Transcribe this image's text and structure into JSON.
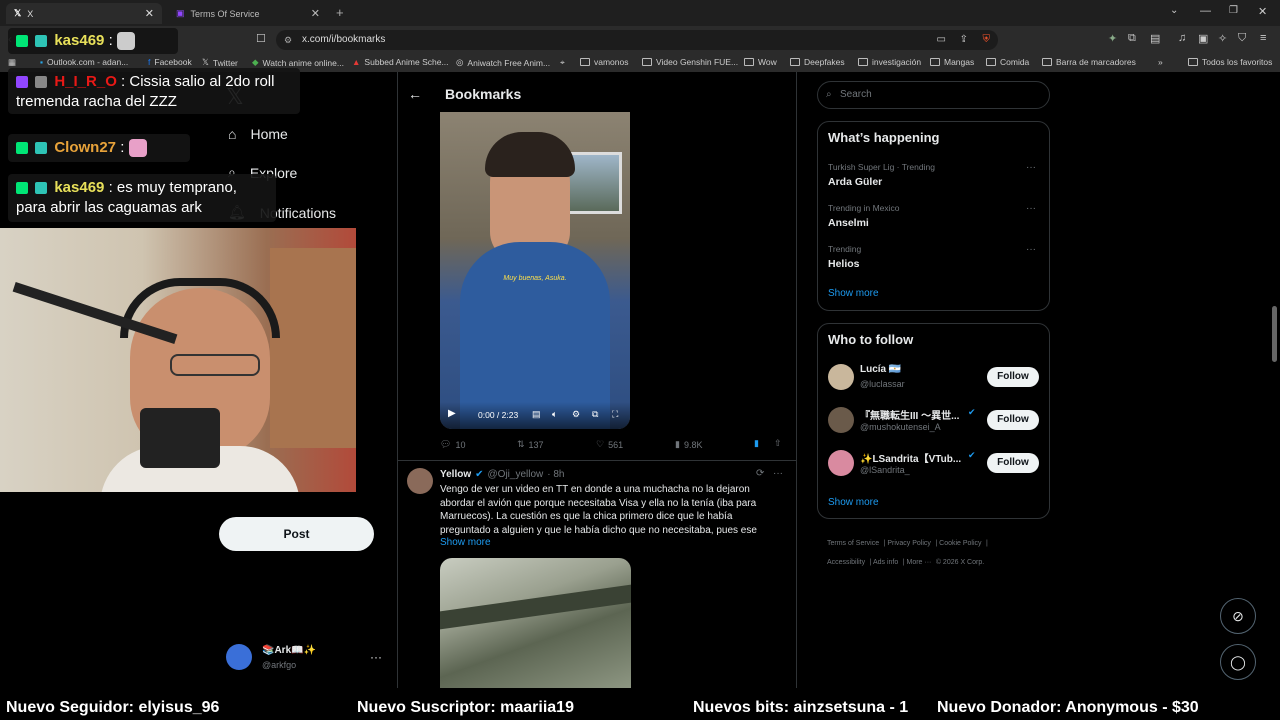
{
  "browser": {
    "tabs": [
      {
        "label": "X",
        "active": true
      },
      {
        "label": "Terms Of Service",
        "active": false
      }
    ],
    "url": "x.com/i/bookmarks",
    "bookmarks_bar": [
      "Outlook.com - adan...",
      "Facebook",
      "Twitter",
      "Watch anime online...",
      "Subbed Anime Sche...",
      "Aniwatch Free Anim...",
      "vamonos",
      "Video Genshin FUE...",
      "Wow",
      "Deepfakes",
      "investigación",
      "Mangas",
      "Comida",
      "Barra de marcadores"
    ],
    "all_favorites": "Todos los favoritos"
  },
  "stream_chat": [
    {
      "user": "H_I_R_O",
      "text": "Cissia salio al 2do roll tremenda racha del ZZZ",
      "user_color": "#e91916"
    },
    {
      "user": "Clown27",
      "text": "",
      "user_color": "#e8a33a"
    },
    {
      "user": "kas469",
      "text": "es muy temprano, para abrir las caguamas ark",
      "user_color": "#e8e05a"
    }
  ],
  "top_chat_user": "kas469",
  "sidebar": {
    "home": "Home",
    "explore": "Explore",
    "notifications": "Notifications",
    "post_button": "Post",
    "account_name": "📚Ark📖✨",
    "account_handle": "@arkfgo"
  },
  "bookmarks": {
    "title": "Bookmarks",
    "video_subtitle": "Muy buenas, Asuka.",
    "video_time": "0:00 / 2:23",
    "stats": {
      "replies": "10",
      "reposts": "137",
      "likes": "561",
      "views": "9.8K"
    },
    "post2": {
      "name": "Yellow",
      "handle": "@Oji_yellow",
      "time": "· 8h",
      "text": "Vengo de ver un video en TT en donde a una muchacha no la dejaron abordar el avión que porque necesitaba Visa y ella no la tenía (iba para Marruecos). La cuestión es que la chica primero dice que le había preguntado a alguien y que le había dicho que no necesitaba, pues ese",
      "show_more": "Show more"
    }
  },
  "right": {
    "search_placeholder": "Search",
    "whats_happening": "What’s happening",
    "trends": [
      {
        "meta": "Turkish Super Lig · Trending",
        "name": "Arda Güler"
      },
      {
        "meta": "Trending in Mexico",
        "name": "Anselmi"
      },
      {
        "meta": "Trending",
        "name": "Helios"
      }
    ],
    "show_more": "Show more",
    "who_to_follow": "Who to follow",
    "follows": [
      {
        "name": "Lucía 🇦🇷",
        "handle": "@luclassar",
        "button": "Follow",
        "avatar_color": "#c9b79c"
      },
      {
        "name": "『無職転生III ～異世...",
        "handle": "@mushokutensei_A",
        "button": "Follow",
        "avatar_color": "#6a5a4a"
      },
      {
        "name": "✨LSandrita【VTub...",
        "handle": "@lSandrita_",
        "button": "Follow",
        "avatar_color": "#d98aa0"
      }
    ],
    "show_more_2": "Show more",
    "footer": [
      "Terms of Service",
      "Privacy Policy",
      "Cookie Policy",
      "Accessibility",
      "Ads info",
      "More ···",
      "© 2026 X Corp."
    ]
  },
  "ticker": {
    "follower": "Nuevo Seguidor: elyisus_96",
    "subscriber": "Nuevo Suscriptor: maariia19",
    "bits": "Nuevos bits: ainzsetsuna - 1",
    "donor": "Nuevo Donador: Anonymous - $30"
  }
}
